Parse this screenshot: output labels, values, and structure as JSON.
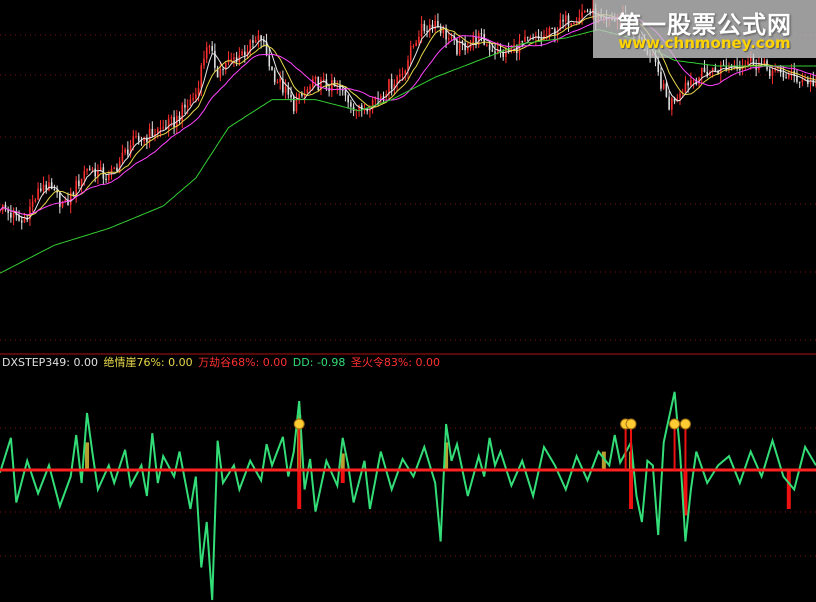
{
  "colors": {
    "background": "#000000",
    "grid": "#7a1010",
    "separator": "#b01010",
    "ma_short": "#e8e8e8",
    "ma_mid": "#e8d84a",
    "ma_long": "#ff44ff",
    "ma_trend": "#33cc33",
    "candle_up": "#ff3030",
    "candle_down": "#e0e0e0",
    "oscillator": "#33dd77",
    "zero_line": "#ff2020",
    "bar_positive": "#b8a030",
    "bar_negative": "#ee1111",
    "icon": "#ffcc33"
  },
  "legend": {
    "dxstep": "DXSTEP349: 0.00",
    "cliff": "绝情崖76%: 0.00",
    "valley": "万劫谷68%: 0.00",
    "dd": "DD: -0.98",
    "fire": "圣火令83%: 0.00"
  },
  "legend_colors": {
    "dxstep": "#e0e0e0",
    "cliff": "#e8d84a",
    "valley": "#ff3030",
    "dd": "#33dd77",
    "fire": "#ff3030"
  },
  "watermark": {
    "title": "第一股票公式网",
    "url": "www.chnmoney.com"
  },
  "chart_data": [
    {
      "type": "line",
      "name": "price-panel",
      "x_range": [
        0,
        150
      ],
      "ylim": [
        0,
        100
      ],
      "price_points": [
        [
          0,
          30
        ],
        [
          4,
          24
        ],
        [
          8,
          38
        ],
        [
          12,
          30
        ],
        [
          16,
          44
        ],
        [
          20,
          40
        ],
        [
          24,
          52
        ],
        [
          28,
          56
        ],
        [
          32,
          60
        ],
        [
          36,
          70
        ],
        [
          38,
          88
        ],
        [
          40,
          78
        ],
        [
          44,
          84
        ],
        [
          48,
          90
        ],
        [
          50,
          78
        ],
        [
          54,
          66
        ],
        [
          58,
          74
        ],
        [
          62,
          72
        ],
        [
          66,
          64
        ],
        [
          70,
          70
        ],
        [
          74,
          78
        ],
        [
          77,
          92
        ],
        [
          80,
          96
        ],
        [
          84,
          86
        ],
        [
          88,
          90
        ],
        [
          92,
          84
        ],
        [
          96,
          88
        ],
        [
          100,
          90
        ],
        [
          104,
          96
        ],
        [
          108,
          100
        ],
        [
          111,
          95
        ],
        [
          115,
          98
        ],
        [
          120,
          82
        ],
        [
          123,
          66
        ],
        [
          126,
          74
        ],
        [
          130,
          78
        ],
        [
          134,
          80
        ],
        [
          138,
          82
        ],
        [
          142,
          78
        ],
        [
          146,
          76
        ],
        [
          150,
          74
        ]
      ],
      "ma_trend_points": [
        [
          0,
          6
        ],
        [
          10,
          16
        ],
        [
          20,
          22
        ],
        [
          30,
          30
        ],
        [
          36,
          40
        ],
        [
          42,
          58
        ],
        [
          50,
          68
        ],
        [
          58,
          68
        ],
        [
          66,
          64
        ],
        [
          72,
          68
        ],
        [
          80,
          76
        ],
        [
          88,
          82
        ],
        [
          96,
          88
        ],
        [
          104,
          90
        ],
        [
          110,
          93
        ],
        [
          116,
          90
        ],
        [
          124,
          82
        ],
        [
          132,
          80
        ],
        [
          140,
          80
        ],
        [
          150,
          80
        ]
      ]
    },
    {
      "type": "line",
      "name": "DD",
      "x_range": [
        0,
        150
      ],
      "ylim": [
        -1,
        1
      ],
      "points": [
        [
          0,
          -0.02
        ],
        [
          2,
          0.35
        ],
        [
          3,
          -0.25
        ],
        [
          5,
          0.1
        ],
        [
          7,
          -0.18
        ],
        [
          9,
          0.05
        ],
        [
          11,
          -0.28
        ],
        [
          13,
          -0.05
        ],
        [
          14,
          0.38
        ],
        [
          15,
          -0.1
        ],
        [
          16,
          0.62
        ],
        [
          17,
          0.18
        ],
        [
          18,
          -0.15
        ],
        [
          20,
          0.05
        ],
        [
          21,
          -0.1
        ],
        [
          23,
          0.22
        ],
        [
          24,
          -0.12
        ],
        [
          26,
          0.05
        ],
        [
          27,
          -0.2
        ],
        [
          28,
          0.4
        ],
        [
          29,
          -0.1
        ],
        [
          30,
          0.15
        ],
        [
          32,
          -0.05
        ],
        [
          33,
          0.2
        ],
        [
          35,
          -0.3
        ],
        [
          36,
          -0.05
        ],
        [
          37,
          -0.75
        ],
        [
          38,
          -0.4
        ],
        [
          39,
          -1.0
        ],
        [
          40,
          0.32
        ],
        [
          41,
          -0.1
        ],
        [
          43,
          0.05
        ],
        [
          44,
          -0.15
        ],
        [
          46,
          0.1
        ],
        [
          48,
          -0.08
        ],
        [
          49,
          0.28
        ],
        [
          50,
          0.05
        ],
        [
          52,
          0.36
        ],
        [
          53,
          -0.05
        ],
        [
          54,
          0.2
        ],
        [
          55,
          0.75
        ],
        [
          56,
          -0.15
        ],
        [
          57,
          0.12
        ],
        [
          58,
          -0.32
        ],
        [
          60,
          0.1
        ],
        [
          62,
          -0.12
        ],
        [
          63,
          0.35
        ],
        [
          64,
          0.05
        ],
        [
          65,
          -0.25
        ],
        [
          67,
          0.1
        ],
        [
          68,
          -0.3
        ],
        [
          70,
          0.2
        ],
        [
          72,
          -0.15
        ],
        [
          74,
          0.12
        ],
        [
          76,
          -0.05
        ],
        [
          78,
          0.25
        ],
        [
          80,
          -0.1
        ],
        [
          81,
          -0.55
        ],
        [
          82,
          0.5
        ],
        [
          83,
          0.1
        ],
        [
          84,
          0.28
        ],
        [
          86,
          -0.2
        ],
        [
          88,
          0.15
        ],
        [
          89,
          -0.05
        ],
        [
          90,
          0.35
        ],
        [
          91,
          0.05
        ],
        [
          92,
          0.2
        ],
        [
          94,
          -0.12
        ],
        [
          96,
          0.1
        ],
        [
          98,
          -0.2
        ],
        [
          100,
          0.25
        ],
        [
          102,
          0.05
        ],
        [
          104,
          -0.15
        ],
        [
          106,
          0.15
        ],
        [
          108,
          -0.08
        ],
        [
          110,
          0.2
        ],
        [
          112,
          0.05
        ],
        [
          113,
          0.38
        ],
        [
          114,
          0.08
        ],
        [
          116,
          0.3
        ],
        [
          117,
          -0.2
        ],
        [
          118,
          -0.4
        ],
        [
          119,
          0.1
        ],
        [
          120,
          0.05
        ],
        [
          121,
          -0.5
        ],
        [
          122,
          0.3
        ],
        [
          124,
          0.85
        ],
        [
          125,
          0.2
        ],
        [
          126,
          -0.55
        ],
        [
          127,
          -0.15
        ],
        [
          128,
          0.2
        ],
        [
          130,
          -0.1
        ],
        [
          132,
          0.05
        ],
        [
          134,
          0.15
        ],
        [
          136,
          -0.1
        ],
        [
          138,
          0.2
        ],
        [
          140,
          -0.05
        ],
        [
          142,
          0.32
        ],
        [
          144,
          -0.05
        ],
        [
          146,
          -0.15
        ],
        [
          148,
          0.25
        ],
        [
          150,
          0.05
        ]
      ],
      "positive_bars": [
        [
          16,
          0.3
        ],
        [
          55,
          0.6
        ],
        [
          63,
          0.18
        ],
        [
          82,
          0.3
        ],
        [
          111,
          0.2
        ],
        [
          116,
          0.2
        ]
      ],
      "negative_bars": [
        [
          55,
          -0.3
        ],
        [
          63,
          -0.1
        ],
        [
          116,
          -0.3
        ],
        [
          126,
          -0.35
        ],
        [
          145,
          -0.3
        ]
      ],
      "markers": [
        55,
        115,
        116,
        124,
        126
      ]
    }
  ]
}
